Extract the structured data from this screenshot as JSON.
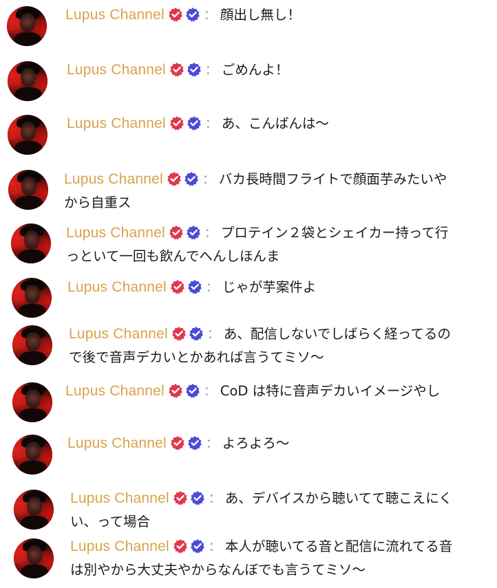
{
  "chat": {
    "username": "Lupus Channel",
    "separator": "：",
    "badge_icons": [
      "red-verified-check-icon",
      "blue-verified-check-icon"
    ],
    "colors": {
      "username": "#d9a24a",
      "badge_red": "#e0374e",
      "badge_blue": "#4b4bd8",
      "text": "#1b1b1b"
    },
    "messages": [
      {
        "lines": [
          "顔出し無し！"
        ]
      },
      {
        "lines": [
          "ごめんよ！"
        ]
      },
      {
        "lines": [
          "あ、こんばんは〜"
        ]
      },
      {
        "lines": [
          "バカ長時間フライトで顔面芋みたいや",
          "から自重ス"
        ]
      },
      {
        "lines": [
          "プロテイン２袋とシェイカー持って行",
          "っといて一回も飲んでへんしほんま"
        ]
      },
      {
        "lines": [
          "じゃが芋案件よ"
        ]
      },
      {
        "lines": [
          "あ、配信しないでしばらく経ってるの",
          "で後で音声デカいとかあれば言うてミソ〜"
        ]
      },
      {
        "lines": [
          "CoD は特に音声デカいイメージやし"
        ]
      },
      {
        "lines": [
          "よろよろ〜"
        ]
      },
      {
        "lines": [
          "あ、デバイスから聴いてて聴こえにく",
          "い、って場合"
        ]
      },
      {
        "lines": [
          "本人が聴いてる音と配信に流れてる音",
          "は別やから大丈夫やからなんぼでも言うてミソ〜"
        ]
      }
    ]
  }
}
